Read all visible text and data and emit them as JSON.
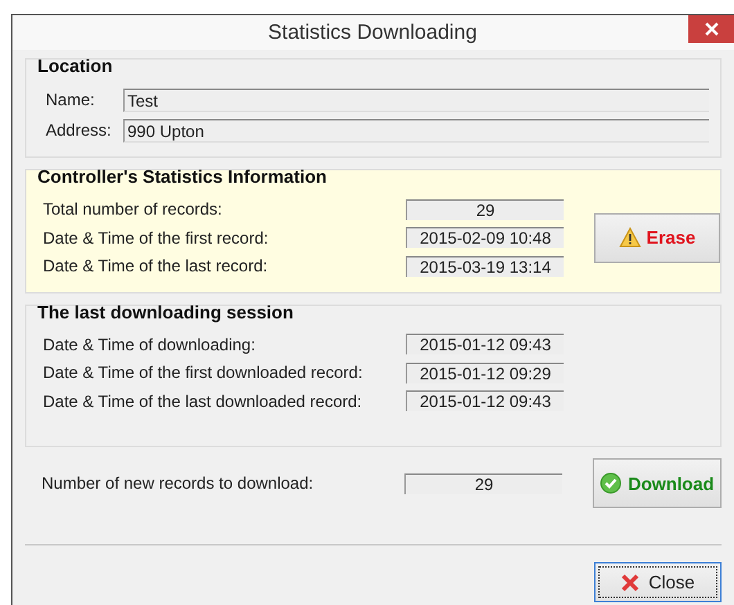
{
  "window": {
    "title": "Statistics Downloading"
  },
  "location": {
    "title": "Location",
    "fields": [
      {
        "label": "Name:",
        "value": "Test"
      },
      {
        "label": "Address:",
        "value": "990 Upton"
      }
    ]
  },
  "controller": {
    "title": "Controller's Statistics Information",
    "rows": [
      {
        "label": "Total number of records:",
        "value": "29"
      },
      {
        "label": "Date & Time of the first record:",
        "value": "2015-02-09 10:48"
      },
      {
        "label": "Date & Time of the last record:",
        "value": "2015-03-19 13:14"
      }
    ],
    "button": {
      "label": "Erase",
      "kind": "warning"
    }
  },
  "session": {
    "title": "The last downloading session",
    "rows": [
      {
        "label": "Date & Time of downloading:",
        "value": "2015-01-12 09:43"
      },
      {
        "label": "Date & Time of the first downloaded record:",
        "value": "2015-01-12 09:29"
      },
      {
        "label": "Date & Time of the last downloaded record:",
        "value": "2015-01-12 09:43"
      }
    ]
  },
  "new_records": {
    "label": "Number of new records to download:",
    "value": "29",
    "button": {
      "label": "Download",
      "kind": "ok"
    }
  },
  "close_button": {
    "label": "Close",
    "kind": "cancel",
    "focused": true
  }
}
